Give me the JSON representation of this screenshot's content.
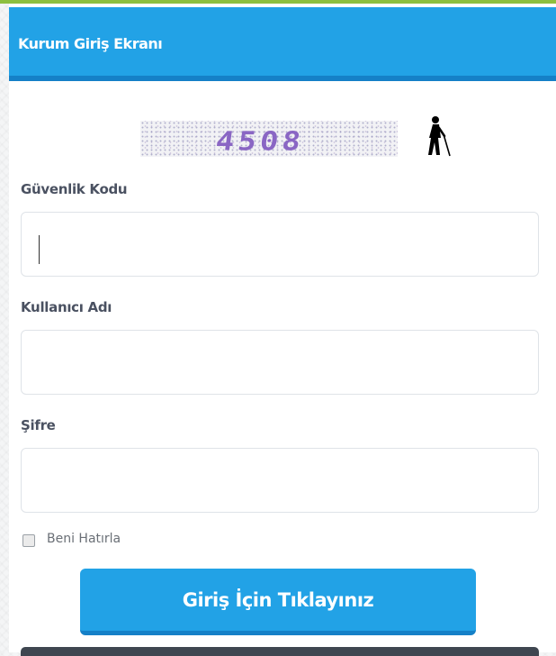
{
  "header": {
    "title": "Kurum Giriş Ekranı"
  },
  "captcha": {
    "code": "4508",
    "audio_icon": "accessibility-person-cane-icon"
  },
  "fields": {
    "security_code": {
      "label": "Güvenlik Kodu",
      "value": "",
      "placeholder": ""
    },
    "username": {
      "label": "Kullanıcı Adı",
      "value": "",
      "placeholder": ""
    },
    "password": {
      "label": "Şifre",
      "value": "",
      "placeholder": ""
    }
  },
  "remember": {
    "label": "Beni Hatırla",
    "checked": false
  },
  "login_button": {
    "label": "Giriş İçin Tıklayınız"
  },
  "colors": {
    "primary": "#22a2e6",
    "primary_dark": "#1580c7",
    "label": "#4a5161",
    "top_accent": "#8dbf3f"
  }
}
